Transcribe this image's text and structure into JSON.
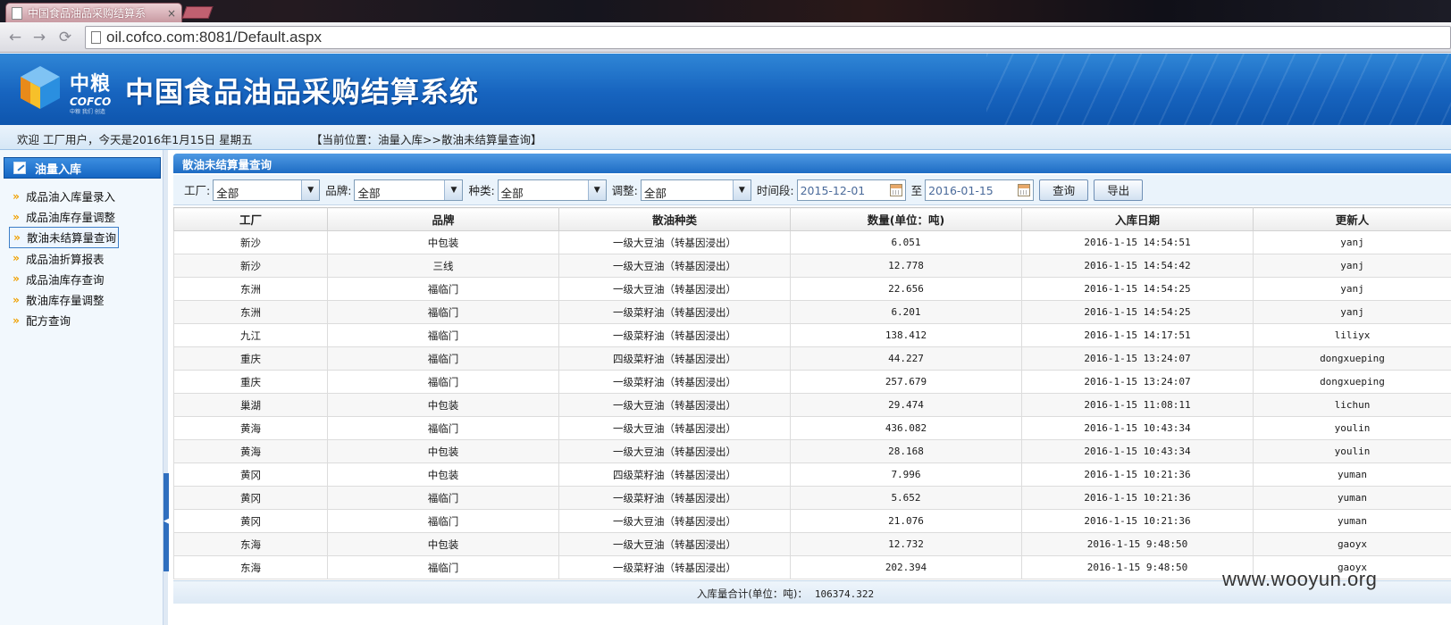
{
  "browser": {
    "tab_title": "中国食品油品采购结算系",
    "tab_close": "×",
    "back": "←",
    "forward": "→",
    "reload": "⟳",
    "url": "oil.cofco.com:8081/Default.aspx"
  },
  "header": {
    "logo_cn": "中粮",
    "logo_en": "COFCO",
    "logo_small": "中粮 我们 创造",
    "system_title": "中国食品油品采购结算系统",
    "brand_colors": {
      "blue": "#1764bf",
      "cube_yellow": "#f6c02a",
      "cube_orange": "#e88a1a",
      "cube_blue": "#2a8fe0"
    }
  },
  "status": {
    "welcome": "欢迎  工厂用户，今天是2016年1月15日  星期五",
    "location": "【当前位置：油量入库>>散油未结算量查询】"
  },
  "sidebar": {
    "title": "油量入库",
    "items": [
      {
        "label": "成品油入库量录入",
        "active": false
      },
      {
        "label": "成品油库存量调整",
        "active": false
      },
      {
        "label": "散油未结算量查询",
        "active": true
      },
      {
        "label": "成品油折算报表",
        "active": false
      },
      {
        "label": "成品油库存查询",
        "active": false
      },
      {
        "label": "散油库存量调整",
        "active": false
      },
      {
        "label": "配方查询",
        "active": false
      }
    ]
  },
  "panel": {
    "title": "散油未结算量查询",
    "filters": {
      "factory_label": "工厂:",
      "factory_value": "全部",
      "brand_label": "品牌:",
      "brand_value": "全部",
      "type_label": "种类:",
      "type_value": "全部",
      "adjust_label": "调整:",
      "adjust_value": "全部",
      "period_label": "时间段:",
      "date_from": "2015-12-01",
      "to_label": "至",
      "date_to": "2016-01-15",
      "query_button": "查询",
      "export_button": "导出"
    },
    "columns": [
      "工厂",
      "品牌",
      "散油种类",
      "数量(单位：吨)",
      "入库日期",
      "更新人"
    ],
    "rows": [
      [
        "新沙",
        "中包装",
        "一级大豆油（转基因浸出）",
        "6.051",
        "2016-1-15 14:54:51",
        "yanj"
      ],
      [
        "新沙",
        "三线",
        "一级大豆油（转基因浸出）",
        "12.778",
        "2016-1-15 14:54:42",
        "yanj"
      ],
      [
        "东洲",
        "福临门",
        "一级大豆油（转基因浸出）",
        "22.656",
        "2016-1-15 14:54:25",
        "yanj"
      ],
      [
        "东洲",
        "福临门",
        "一级菜籽油（转基因浸出）",
        "6.201",
        "2016-1-15 14:54:25",
        "yanj"
      ],
      [
        "九江",
        "福临门",
        "一级菜籽油（转基因浸出）",
        "138.412",
        "2016-1-15 14:17:51",
        "liliyx"
      ],
      [
        "重庆",
        "福临门",
        "四级菜籽油（转基因浸出）",
        "44.227",
        "2016-1-15 13:24:07",
        "dongxueping"
      ],
      [
        "重庆",
        "福临门",
        "一级菜籽油（转基因浸出）",
        "257.679",
        "2016-1-15 13:24:07",
        "dongxueping"
      ],
      [
        "巢湖",
        "中包装",
        "一级大豆油（转基因浸出）",
        "29.474",
        "2016-1-15 11:08:11",
        "lichun"
      ],
      [
        "黄海",
        "福临门",
        "一级大豆油（转基因浸出）",
        "436.082",
        "2016-1-15 10:43:34",
        "youlin"
      ],
      [
        "黄海",
        "中包装",
        "一级大豆油（转基因浸出）",
        "28.168",
        "2016-1-15 10:43:34",
        "youlin"
      ],
      [
        "黄冈",
        "中包装",
        "四级菜籽油（转基因浸出）",
        "7.996",
        "2016-1-15 10:21:36",
        "yuman"
      ],
      [
        "黄冈",
        "福临门",
        "一级菜籽油（转基因浸出）",
        "5.652",
        "2016-1-15 10:21:36",
        "yuman"
      ],
      [
        "黄冈",
        "福临门",
        "一级大豆油（转基因浸出）",
        "21.076",
        "2016-1-15 10:21:36",
        "yuman"
      ],
      [
        "东海",
        "中包装",
        "一级大豆油（转基因浸出）",
        "12.732",
        "2016-1-15 9:48:50",
        "gaoyx"
      ],
      [
        "东海",
        "福临门",
        "一级菜籽油（转基因浸出）",
        "202.394",
        "2016-1-15 9:48:50",
        "gaoyx"
      ]
    ],
    "summary_label": "入库量合计(单位：吨)：",
    "summary_value": "106374.322"
  },
  "watermark": "www.wooyun.org"
}
